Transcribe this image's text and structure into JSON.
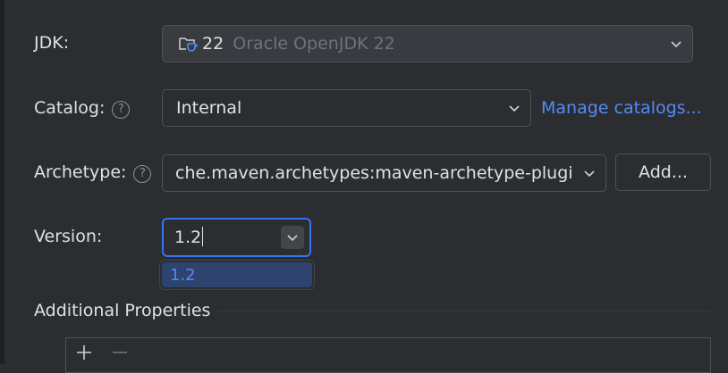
{
  "jdk": {
    "label": "JDK:",
    "version": "22",
    "name": "Oracle OpenJDK 22",
    "icon": "folder-coffee-icon"
  },
  "catalog": {
    "label": "Catalog:",
    "help_glyph": "?",
    "value": "Internal",
    "manage_link": "Manage catalogs..."
  },
  "archetype": {
    "label": "Archetype:",
    "help_glyph": "?",
    "value": "che.maven.archetypes:maven-archetype-plugin",
    "add_label": "Add..."
  },
  "version": {
    "label": "Version:",
    "value": "1.2",
    "options": [
      "1.2"
    ]
  },
  "additional_properties": {
    "title": "Additional Properties",
    "toolbar": {
      "add_icon": "plus-icon",
      "remove_icon": "minus-icon"
    }
  },
  "colors": {
    "background": "#2b2d30",
    "accent": "#3574f0",
    "link": "#548af7",
    "muted_text": "#6f737a"
  }
}
